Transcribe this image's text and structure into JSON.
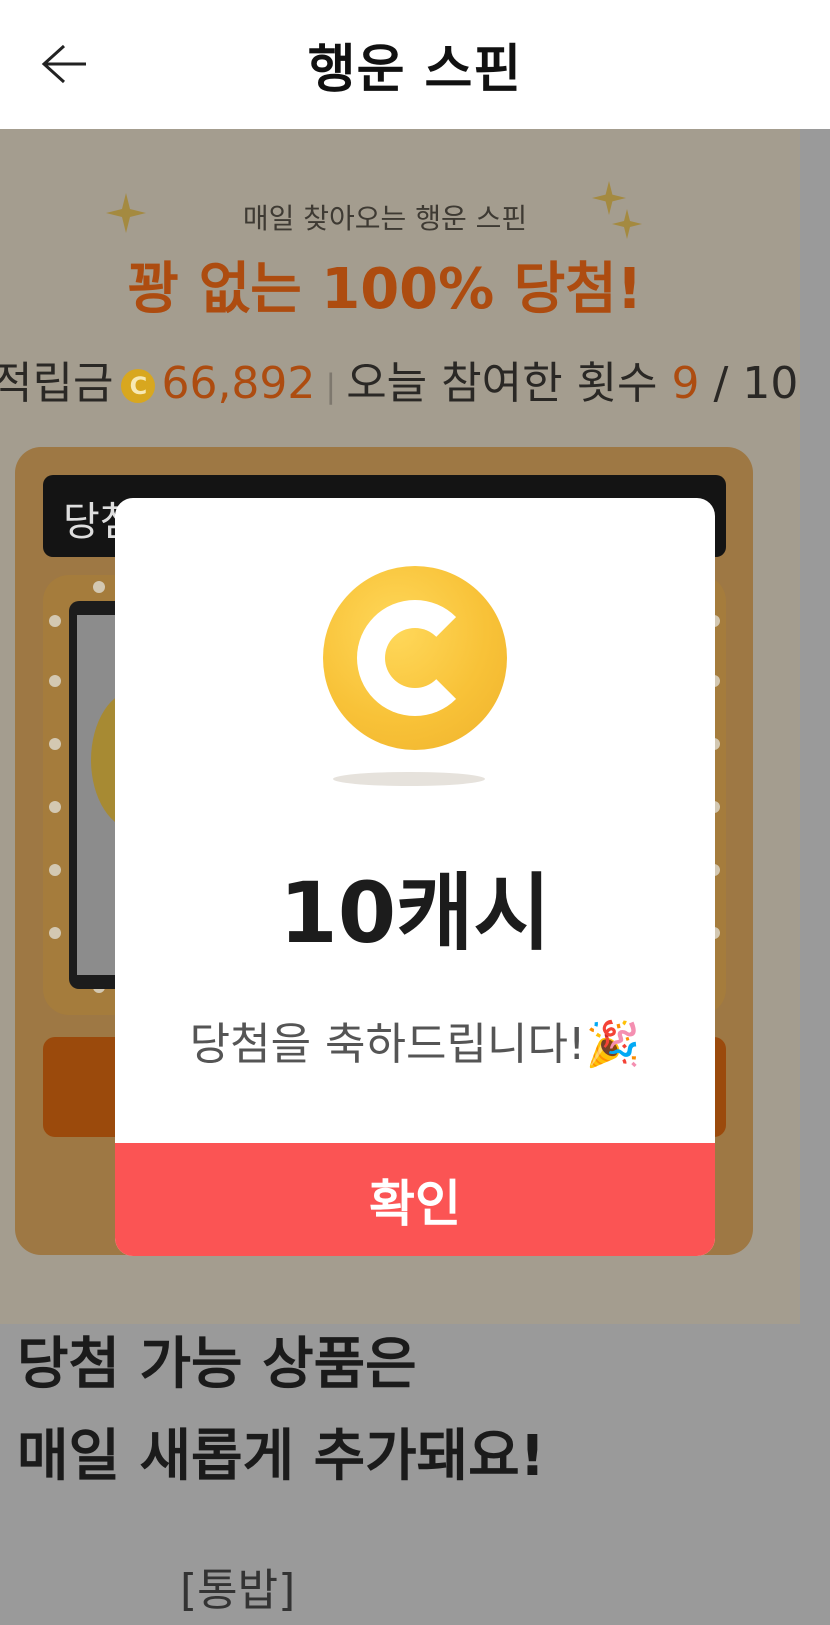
{
  "header": {
    "title": "행운 스핀",
    "back_icon": "arrow-left-icon"
  },
  "hero": {
    "subtitle": "매일 찾아오는 행운 스핀",
    "headline": "꽝 없는 100% 당첨!",
    "coin_icon_glyph": "C"
  },
  "stats": {
    "balance_label": "적립금",
    "balance_value": "66,892",
    "participation_label": "오늘 참여한 횟수",
    "participation_count": "9",
    "participation_total": "/ 10"
  },
  "board": {
    "bar_text": "당첨"
  },
  "lower": {
    "title_line1": "당첨 가능 상품은",
    "title_line2": "매일 새롭게 추가돼요!",
    "product_label": "[통밥]"
  },
  "dialog": {
    "prize": "10캐시",
    "message": "당첨을 축하드립니다!🎉",
    "confirm_label": "확인"
  },
  "colors": {
    "accent_orange": "#ad4c10",
    "confirm_red": "#fb5454",
    "coin_gold": "#f8c238"
  }
}
